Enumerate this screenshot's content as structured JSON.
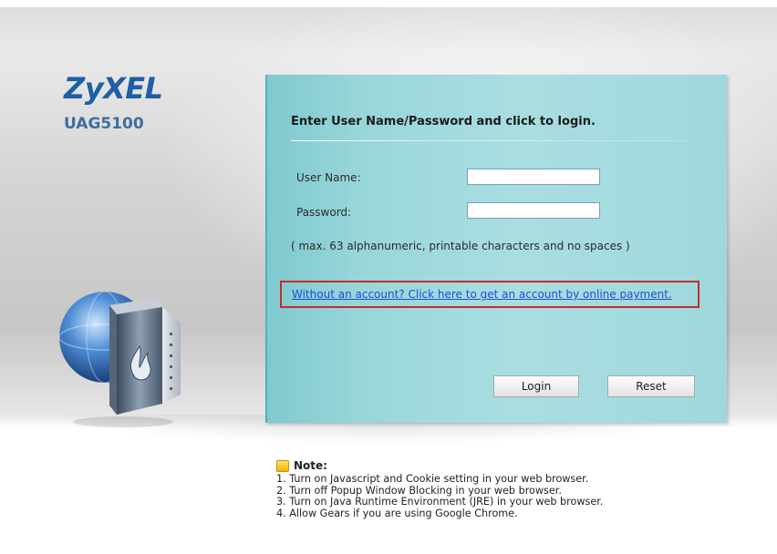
{
  "brand": {
    "logo_text": "ZyXEL",
    "model": "UAG5100"
  },
  "login": {
    "title": "Enter User Name/Password and click to login.",
    "username_label": "User Name:",
    "username_value": "",
    "password_label": "Password:",
    "password_value": "",
    "hint": "( max. 63 alphanumeric, printable characters and no spaces )",
    "signup_link": "Without an account? Click here to get an account by online payment.",
    "login_button": "Login",
    "reset_button": "Reset"
  },
  "note": {
    "title": "Note:",
    "items": [
      "1. Turn on Javascript and Cookie setting in your web browser.",
      "2. Turn off Popup Window Blocking in your web browser.",
      "3. Turn on Java Runtime Environment (JRE) in your web browser.",
      "4. Allow Gears if you are using Google Chrome."
    ]
  },
  "colors": {
    "brand_blue": "#1f5fa8",
    "panel_teal": "#9fd8dc",
    "link_blue": "#1e4fd6",
    "highlight_red": "#c92a2a"
  },
  "icons": {
    "device": "firewall-globe-icon",
    "note": "note-icon"
  }
}
